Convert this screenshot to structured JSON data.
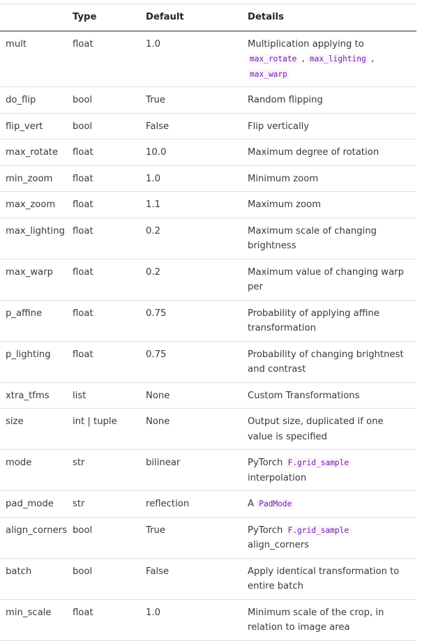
{
  "headers": {
    "name": "",
    "type": "Type",
    "default": "Default",
    "details": "Details"
  },
  "rows": [
    {
      "name": "mult",
      "type": "float",
      "default": "1.0",
      "details": [
        {
          "t": "text",
          "v": "Multiplication applying to "
        },
        {
          "t": "code",
          "v": "max_rotate"
        },
        {
          "t": "text",
          "v": " , "
        },
        {
          "t": "code",
          "v": "max_lighting"
        },
        {
          "t": "text",
          "v": " , "
        },
        {
          "t": "code",
          "v": "max_warp"
        }
      ]
    },
    {
      "name": "do_flip",
      "type": "bool",
      "default": "True",
      "details": [
        {
          "t": "text",
          "v": "Random flipping"
        }
      ]
    },
    {
      "name": "flip_vert",
      "type": "bool",
      "default": "False",
      "details": [
        {
          "t": "text",
          "v": "Flip vertically"
        }
      ]
    },
    {
      "name": "max_rotate",
      "type": "float",
      "default": "10.0",
      "details": [
        {
          "t": "text",
          "v": "Maximum degree of rotation"
        }
      ]
    },
    {
      "name": "min_zoom",
      "type": "float",
      "default": "1.0",
      "details": [
        {
          "t": "text",
          "v": "Minimum zoom"
        }
      ]
    },
    {
      "name": "max_zoom",
      "type": "float",
      "default": "1.1",
      "details": [
        {
          "t": "text",
          "v": "Maximum zoom"
        }
      ]
    },
    {
      "name": "max_lighting",
      "type": "float",
      "default": "0.2",
      "details": [
        {
          "t": "text",
          "v": "Maximum scale of changing brightness"
        }
      ]
    },
    {
      "name": "max_warp",
      "type": "float",
      "default": "0.2",
      "details": [
        {
          "t": "text",
          "v": "Maximum value of changing warp per"
        }
      ]
    },
    {
      "name": "p_affine",
      "type": "float",
      "default": "0.75",
      "details": [
        {
          "t": "text",
          "v": "Probability of applying affine transformation"
        }
      ]
    },
    {
      "name": "p_lighting",
      "type": "float",
      "default": "0.75",
      "details": [
        {
          "t": "text",
          "v": "Probability of changing brightnest and contrast"
        }
      ]
    },
    {
      "name": "xtra_tfms",
      "type": "list",
      "default": "None",
      "details": [
        {
          "t": "text",
          "v": "Custom Transformations"
        }
      ]
    },
    {
      "name": "size",
      "type": "int | tuple",
      "default": "None",
      "details": [
        {
          "t": "text",
          "v": "Output size, duplicated if one value is specified"
        }
      ]
    },
    {
      "name": "mode",
      "type": "str",
      "default": "bilinear",
      "details": [
        {
          "t": "text",
          "v": "PyTorch "
        },
        {
          "t": "code",
          "v": "F.grid_sample"
        },
        {
          "t": "text",
          "v": " interpolation"
        }
      ]
    },
    {
      "name": "pad_mode",
      "type": "str",
      "default": "reflection",
      "details": [
        {
          "t": "text",
          "v": "A "
        },
        {
          "t": "code",
          "v": "PadMode"
        }
      ]
    },
    {
      "name": "align_corners",
      "type": "bool",
      "default": "True",
      "details": [
        {
          "t": "text",
          "v": "PyTorch "
        },
        {
          "t": "code",
          "v": "F.grid_sample"
        },
        {
          "t": "text",
          "v": " align_corners"
        }
      ]
    },
    {
      "name": "batch",
      "type": "bool",
      "default": "False",
      "details": [
        {
          "t": "text",
          "v": "Apply identical transformation to entire batch"
        }
      ]
    },
    {
      "name": "min_scale",
      "type": "float",
      "default": "1.0",
      "details": [
        {
          "t": "text",
          "v": "Minimum scale of the crop, in relation to image area"
        }
      ]
    }
  ]
}
